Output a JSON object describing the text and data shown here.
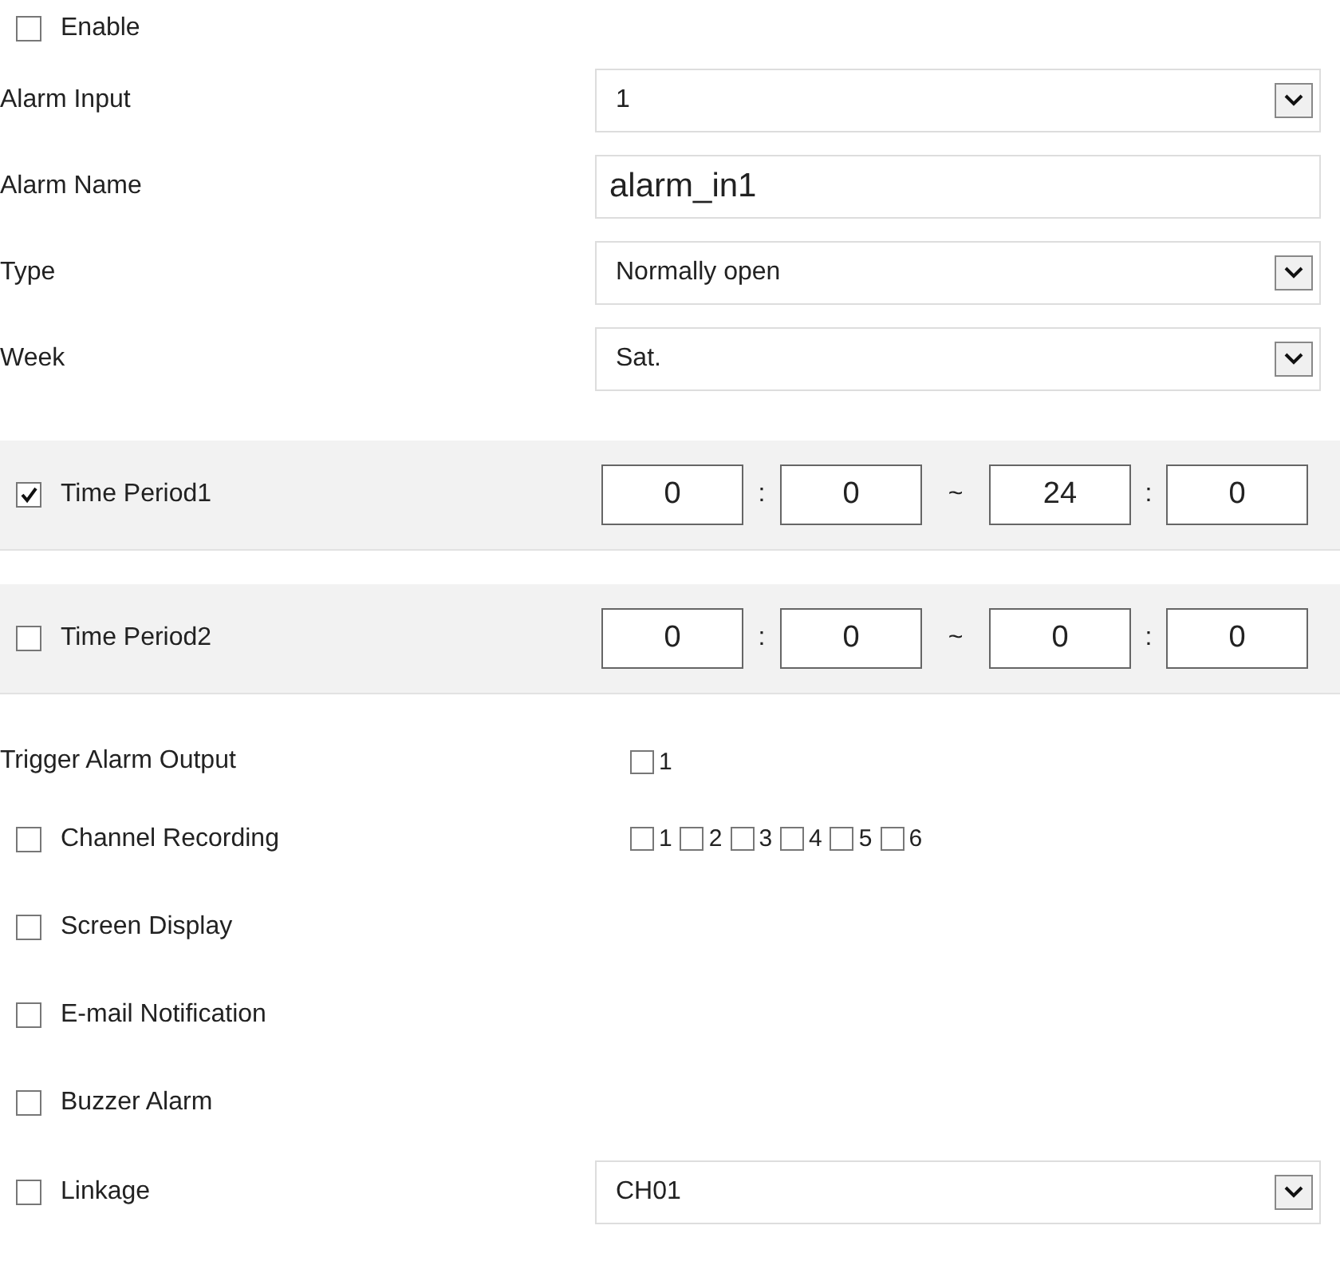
{
  "enable": {
    "label": "Enable",
    "checked": false
  },
  "fields": [
    {
      "kind": "select",
      "label": "Alarm Input",
      "value": "1"
    },
    {
      "kind": "text",
      "label": "Alarm Name",
      "value": "alarm_in1"
    },
    {
      "kind": "select",
      "label": "Type",
      "value": "Normally open"
    },
    {
      "kind": "select",
      "label": "Week",
      "value": "Sat."
    }
  ],
  "time_periods": [
    {
      "label": "Time Period1",
      "checked": true,
      "start_hour": "0",
      "hour_separator_1": ":",
      "start_minute": "0",
      "range_separator": "~",
      "end_hour": "24",
      "hour_separator_2": ":",
      "end_minute": "0"
    },
    {
      "label": "Time Period2",
      "checked": false,
      "start_hour": "0",
      "hour_separator_1": ":",
      "start_minute": "0",
      "range_separator": "~",
      "end_hour": "0",
      "hour_separator_2": ":",
      "end_minute": "0"
    }
  ],
  "trigger_alarm_output": {
    "label": "Trigger Alarm Output",
    "outputs": [
      {
        "label": "1",
        "checked": false
      }
    ]
  },
  "actions": [
    {
      "kind": "channels",
      "label": "Channel Recording",
      "checked": false,
      "channels": [
        {
          "label": "1",
          "checked": false
        },
        {
          "label": "2",
          "checked": false
        },
        {
          "label": "3",
          "checked": false
        },
        {
          "label": "4",
          "checked": false
        },
        {
          "label": "5",
          "checked": false
        },
        {
          "label": "6",
          "checked": false
        }
      ]
    },
    {
      "kind": "plain",
      "label": "Screen Display",
      "checked": false
    },
    {
      "kind": "plain",
      "label": "E-mail Notification",
      "checked": false
    },
    {
      "kind": "plain",
      "label": "Buzzer Alarm",
      "checked": false
    },
    {
      "kind": "select",
      "label": "Linkage",
      "checked": false,
      "value": "CH01"
    }
  ]
}
